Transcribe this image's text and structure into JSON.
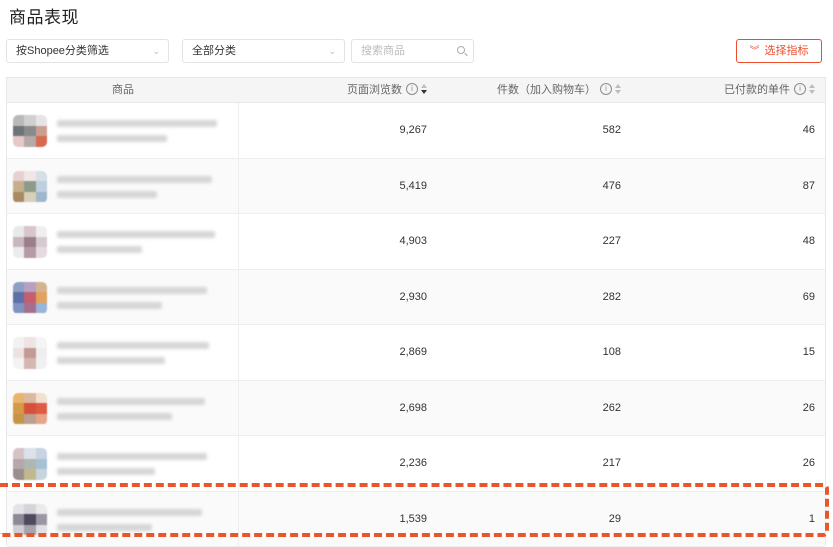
{
  "page": {
    "title": "商品表现"
  },
  "filters": {
    "category_filter": "按Shopee分类筛选",
    "all_categories": "全部分类",
    "search_placeholder": "搜索商品",
    "select_metrics": "选择指标"
  },
  "table": {
    "headers": {
      "product": "商品",
      "page_views": "页面浏览数",
      "add_to_cart": "件数（加入购物车）",
      "paid_units": "已付款的单件"
    },
    "sorted_by": "page_views",
    "sort_direction": "descending",
    "rows": [
      {
        "page_views": "9,267",
        "add_to_cart": "582",
        "paid_units": "46"
      },
      {
        "page_views": "5,419",
        "add_to_cart": "476",
        "paid_units": "87"
      },
      {
        "page_views": "4,903",
        "add_to_cart": "227",
        "paid_units": "48"
      },
      {
        "page_views": "2,930",
        "add_to_cart": "282",
        "paid_units": "69"
      },
      {
        "page_views": "2,869",
        "add_to_cart": "108",
        "paid_units": "15"
      },
      {
        "page_views": "2,698",
        "add_to_cart": "262",
        "paid_units": "26"
      },
      {
        "page_views": "2,236",
        "add_to_cart": "217",
        "paid_units": "26"
      },
      {
        "page_views": "1,539",
        "add_to_cart": "29",
        "paid_units": "1"
      }
    ],
    "highlighted_row": 8
  },
  "colors": {
    "accent": "#ee4d2d",
    "highlight_dash": "#e8562a",
    "header_bg": "#f5f5f5"
  },
  "icons": {
    "info": "info-circle-icon",
    "sort": "sort-icon",
    "chevron": "chevron-down-icon",
    "search": "search-icon",
    "select_metrics": "double-chevron-down-icon"
  }
}
